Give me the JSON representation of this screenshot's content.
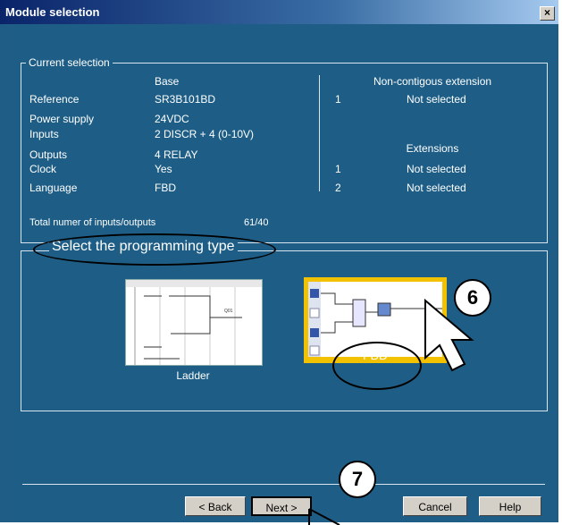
{
  "window": {
    "title": "Module selection",
    "close_glyph": "×"
  },
  "current_selection": {
    "legend": "Current selection",
    "base_header": "Base",
    "rows": [
      {
        "label": "Reference",
        "value": "SR3B101BD"
      },
      {
        "label": "Power supply",
        "value": "24VDC"
      },
      {
        "label": "Inputs",
        "value": "2 DISCR + 4 (0-10V)"
      },
      {
        "label": "Outputs",
        "value": "4 RELAY"
      },
      {
        "label": "Clock",
        "value": "Yes"
      },
      {
        "label": "Language",
        "value": "FBD"
      }
    ],
    "total_label": "Total numer of inputs/outputs",
    "total_value": "61/40",
    "noncontig_header": "Non-contigous extension",
    "noncontig_num": "1",
    "noncontig_value": "Not selected",
    "extensions_header": "Extensions",
    "extensions": [
      {
        "num": "1",
        "value": "Not selected"
      },
      {
        "num": "2",
        "value": "Not selected"
      }
    ]
  },
  "programming": {
    "legend": "Select the programming type",
    "options": [
      {
        "label": "Ladder",
        "selected": false
      },
      {
        "label": "FBD",
        "selected": true
      }
    ]
  },
  "buttons": {
    "back": "< Back",
    "next": "Next >",
    "cancel": "Cancel",
    "help": "Help"
  },
  "annotations": {
    "step6": "6",
    "step7": "7"
  },
  "colors": {
    "dialog_bg": "#1e5e86",
    "selected_border": "#f2c200",
    "button_bg": "#d4d0c8"
  }
}
